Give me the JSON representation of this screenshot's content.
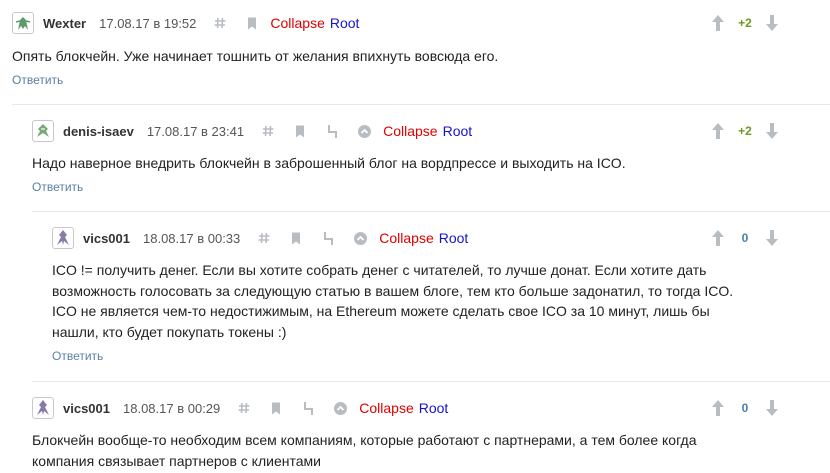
{
  "icons": {
    "hash": "hash-icon",
    "bookmark": "bookmark-icon",
    "parent": "parent-link-icon",
    "up_circle": "scroll-up-icon",
    "vote_up": "vote-up-arrow-icon",
    "vote_down": "vote-down-arrow-icon"
  },
  "colors": {
    "collapse": "#e00000",
    "root": "#1515cc",
    "reply": "#5b7ea3",
    "score_positive": "#6a9a1f",
    "score_zero": "#4a7fa9",
    "icon_gray": "#b8bdc2"
  },
  "comments": [
    {
      "user": "Wexter",
      "time": "17.08.17 в 19:52",
      "collapse": "Collapse",
      "root": "Root",
      "score": "+2",
      "text": "Опять блокчейн. Уже начинает тошнить от желания впихнуть вовсюда его.",
      "reply": "Ответить"
    },
    {
      "user": "denis-isaev",
      "time": "17.08.17 в 23:41",
      "collapse": "Collapse",
      "root": "Root",
      "score": "+2",
      "text": "Надо наверное внедрить блокчейн в заброшенный блог на вордпрессе и выходить на ICO.",
      "reply": "Ответить"
    },
    {
      "user": "vics001",
      "time": "18.08.17 в 00:33",
      "collapse": "Collapse",
      "root": "Root",
      "score": "0",
      "text_lines": [
        "ICO != получить денег. Если вы хотите собрать денег с читателей, то лучше донат. Если хотите дать",
        "возможность голосовать за следующую статью в вашем блоге, тем кто больше задонатил, то тогда ICO.",
        "ICO не является чем-то недостижимым, на Ethereum можете сделать свое ICO за 10 минут, лишь бы",
        "нашли, кто будет покупать токены :)"
      ],
      "reply": "Ответить"
    },
    {
      "user": "vics001",
      "time": "18.08.17 в 00:29",
      "collapse": "Collapse",
      "root": "Root",
      "score": "0",
      "text_lines": [
        "Блокчейн вообще-то необходим всем компаниям, которые работают с партнерами, а тем более когда",
        "компания связывает партнеров с клиентами"
      ]
    }
  ]
}
